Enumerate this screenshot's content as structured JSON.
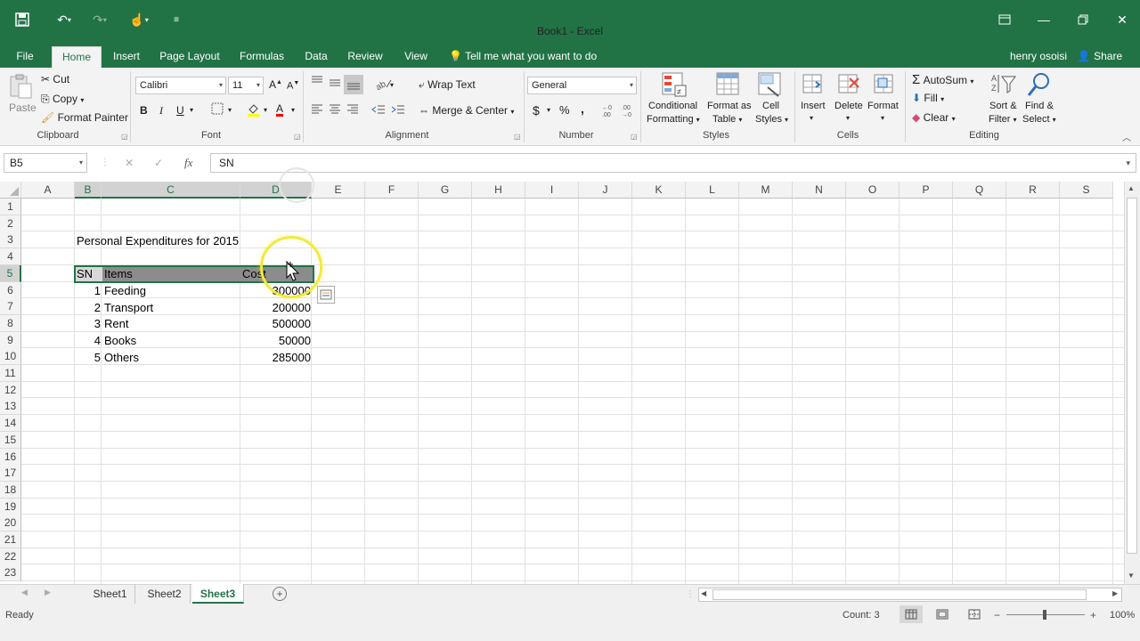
{
  "window": {
    "title": "Book1 - Excel",
    "user": "henry osoisi",
    "share_label": "Share"
  },
  "tabs": [
    "File",
    "Home",
    "Insert",
    "Page Layout",
    "Formulas",
    "Data",
    "Review",
    "View"
  ],
  "tell_me": "Tell me what you want to do",
  "ribbon": {
    "clipboard": {
      "paste": "Paste",
      "cut": "Cut",
      "copy": "Copy",
      "format_painter": "Format Painter",
      "label": "Clipboard"
    },
    "font": {
      "name": "Calibri",
      "size": "11",
      "bold": "B",
      "italic": "I",
      "underline": "U",
      "grow": "A",
      "shrink": "A",
      "font_color": "A",
      "label": "Font"
    },
    "alignment": {
      "wrap_text": "Wrap Text",
      "merge_center": "Merge & Center",
      "label": "Alignment"
    },
    "number": {
      "format": "General",
      "currency": "$",
      "percent": "%",
      "comma": ",",
      "label": "Number"
    },
    "styles": {
      "conditional": "Conditional",
      "conditional2": "Formatting",
      "format_as": "Format as",
      "format_as2": "Table",
      "cell": "Cell",
      "cell2": "Styles",
      "label": "Styles"
    },
    "cells": {
      "insert": "Insert",
      "delete": "Delete",
      "format": "Format",
      "label": "Cells"
    },
    "editing": {
      "autosum": "AutoSum",
      "fill": "Fill",
      "clear": "Clear",
      "sort": "Sort &",
      "sort2": "Filter",
      "find": "Find &",
      "find2": "Select",
      "label": "Editing"
    }
  },
  "formula_bar": {
    "name_box": "B5",
    "fx": "fx",
    "content": "SN"
  },
  "columns": [
    "A",
    "B",
    "C",
    "D",
    "E",
    "F",
    "G",
    "H",
    "I",
    "J",
    "K",
    "L",
    "M",
    "N",
    "O",
    "P",
    "Q",
    "R",
    "S"
  ],
  "rows": [
    "1",
    "2",
    "3",
    "4",
    "5",
    "6",
    "7",
    "8",
    "9",
    "10",
    "11",
    "12",
    "13",
    "14",
    "15",
    "16",
    "17",
    "18",
    "19",
    "20",
    "21",
    "22",
    "23"
  ],
  "sheet": {
    "title": "Personal Expenditures for 2015",
    "headers": {
      "sn": "SN",
      "items": "Items",
      "cost": "Cost"
    },
    "data": [
      {
        "sn": "1",
        "item": "Feeding",
        "cost": "300000"
      },
      {
        "sn": "2",
        "item": "Transport",
        "cost": "200000"
      },
      {
        "sn": "3",
        "item": "Rent",
        "cost": "500000"
      },
      {
        "sn": "4",
        "item": "Books",
        "cost": "50000"
      },
      {
        "sn": "5",
        "item": "Others",
        "cost": "285000"
      }
    ]
  },
  "sheet_tabs": [
    "Sheet1",
    "Sheet2",
    "Sheet3"
  ],
  "active_sheet": "Sheet3",
  "status": {
    "mode": "Ready",
    "count": "Count: 3",
    "zoom": "100%"
  }
}
